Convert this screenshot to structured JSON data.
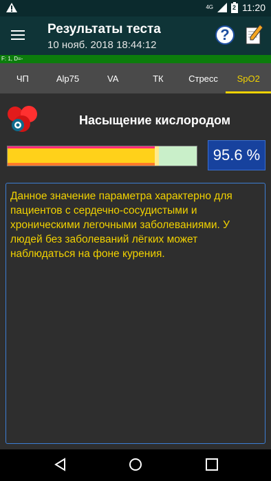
{
  "status_bar": {
    "warning_icon": "warning-icon",
    "network_label": "4G",
    "battery_level": "2",
    "time": "11:20"
  },
  "appbar": {
    "title": "Результаты теста",
    "subtitle": "10 нояб. 2018  18:44:12",
    "menu_icon": "menu-icon",
    "help_label": "?",
    "notes_icon": "notes-icon"
  },
  "debug_line": "F: 1, D=-",
  "tabs": [
    {
      "label": "ЧП",
      "active": false
    },
    {
      "label": "Alp75",
      "active": false
    },
    {
      "label": "VA",
      "active": false
    },
    {
      "label": "ТК",
      "active": false
    },
    {
      "label": "Стресс",
      "active": false
    },
    {
      "label": "SpO2",
      "active": true
    }
  ],
  "param": {
    "title": "Насыщение кислородом",
    "value_text": "95.6 %",
    "value": 95.6,
    "gauge_fill_fraction": 0.79,
    "icon": "blood-cells-icon"
  },
  "description": "Данное значение параметра характерно для пациентов с сердечно-сосудистыми и хроническими легочными заболеваниями. У людей без заболеваний лёгких может наблюдаться на фоне курения.",
  "colors": {
    "accent": "#f2d200",
    "appbar": "#0f3437",
    "value_box": "#17429e"
  }
}
